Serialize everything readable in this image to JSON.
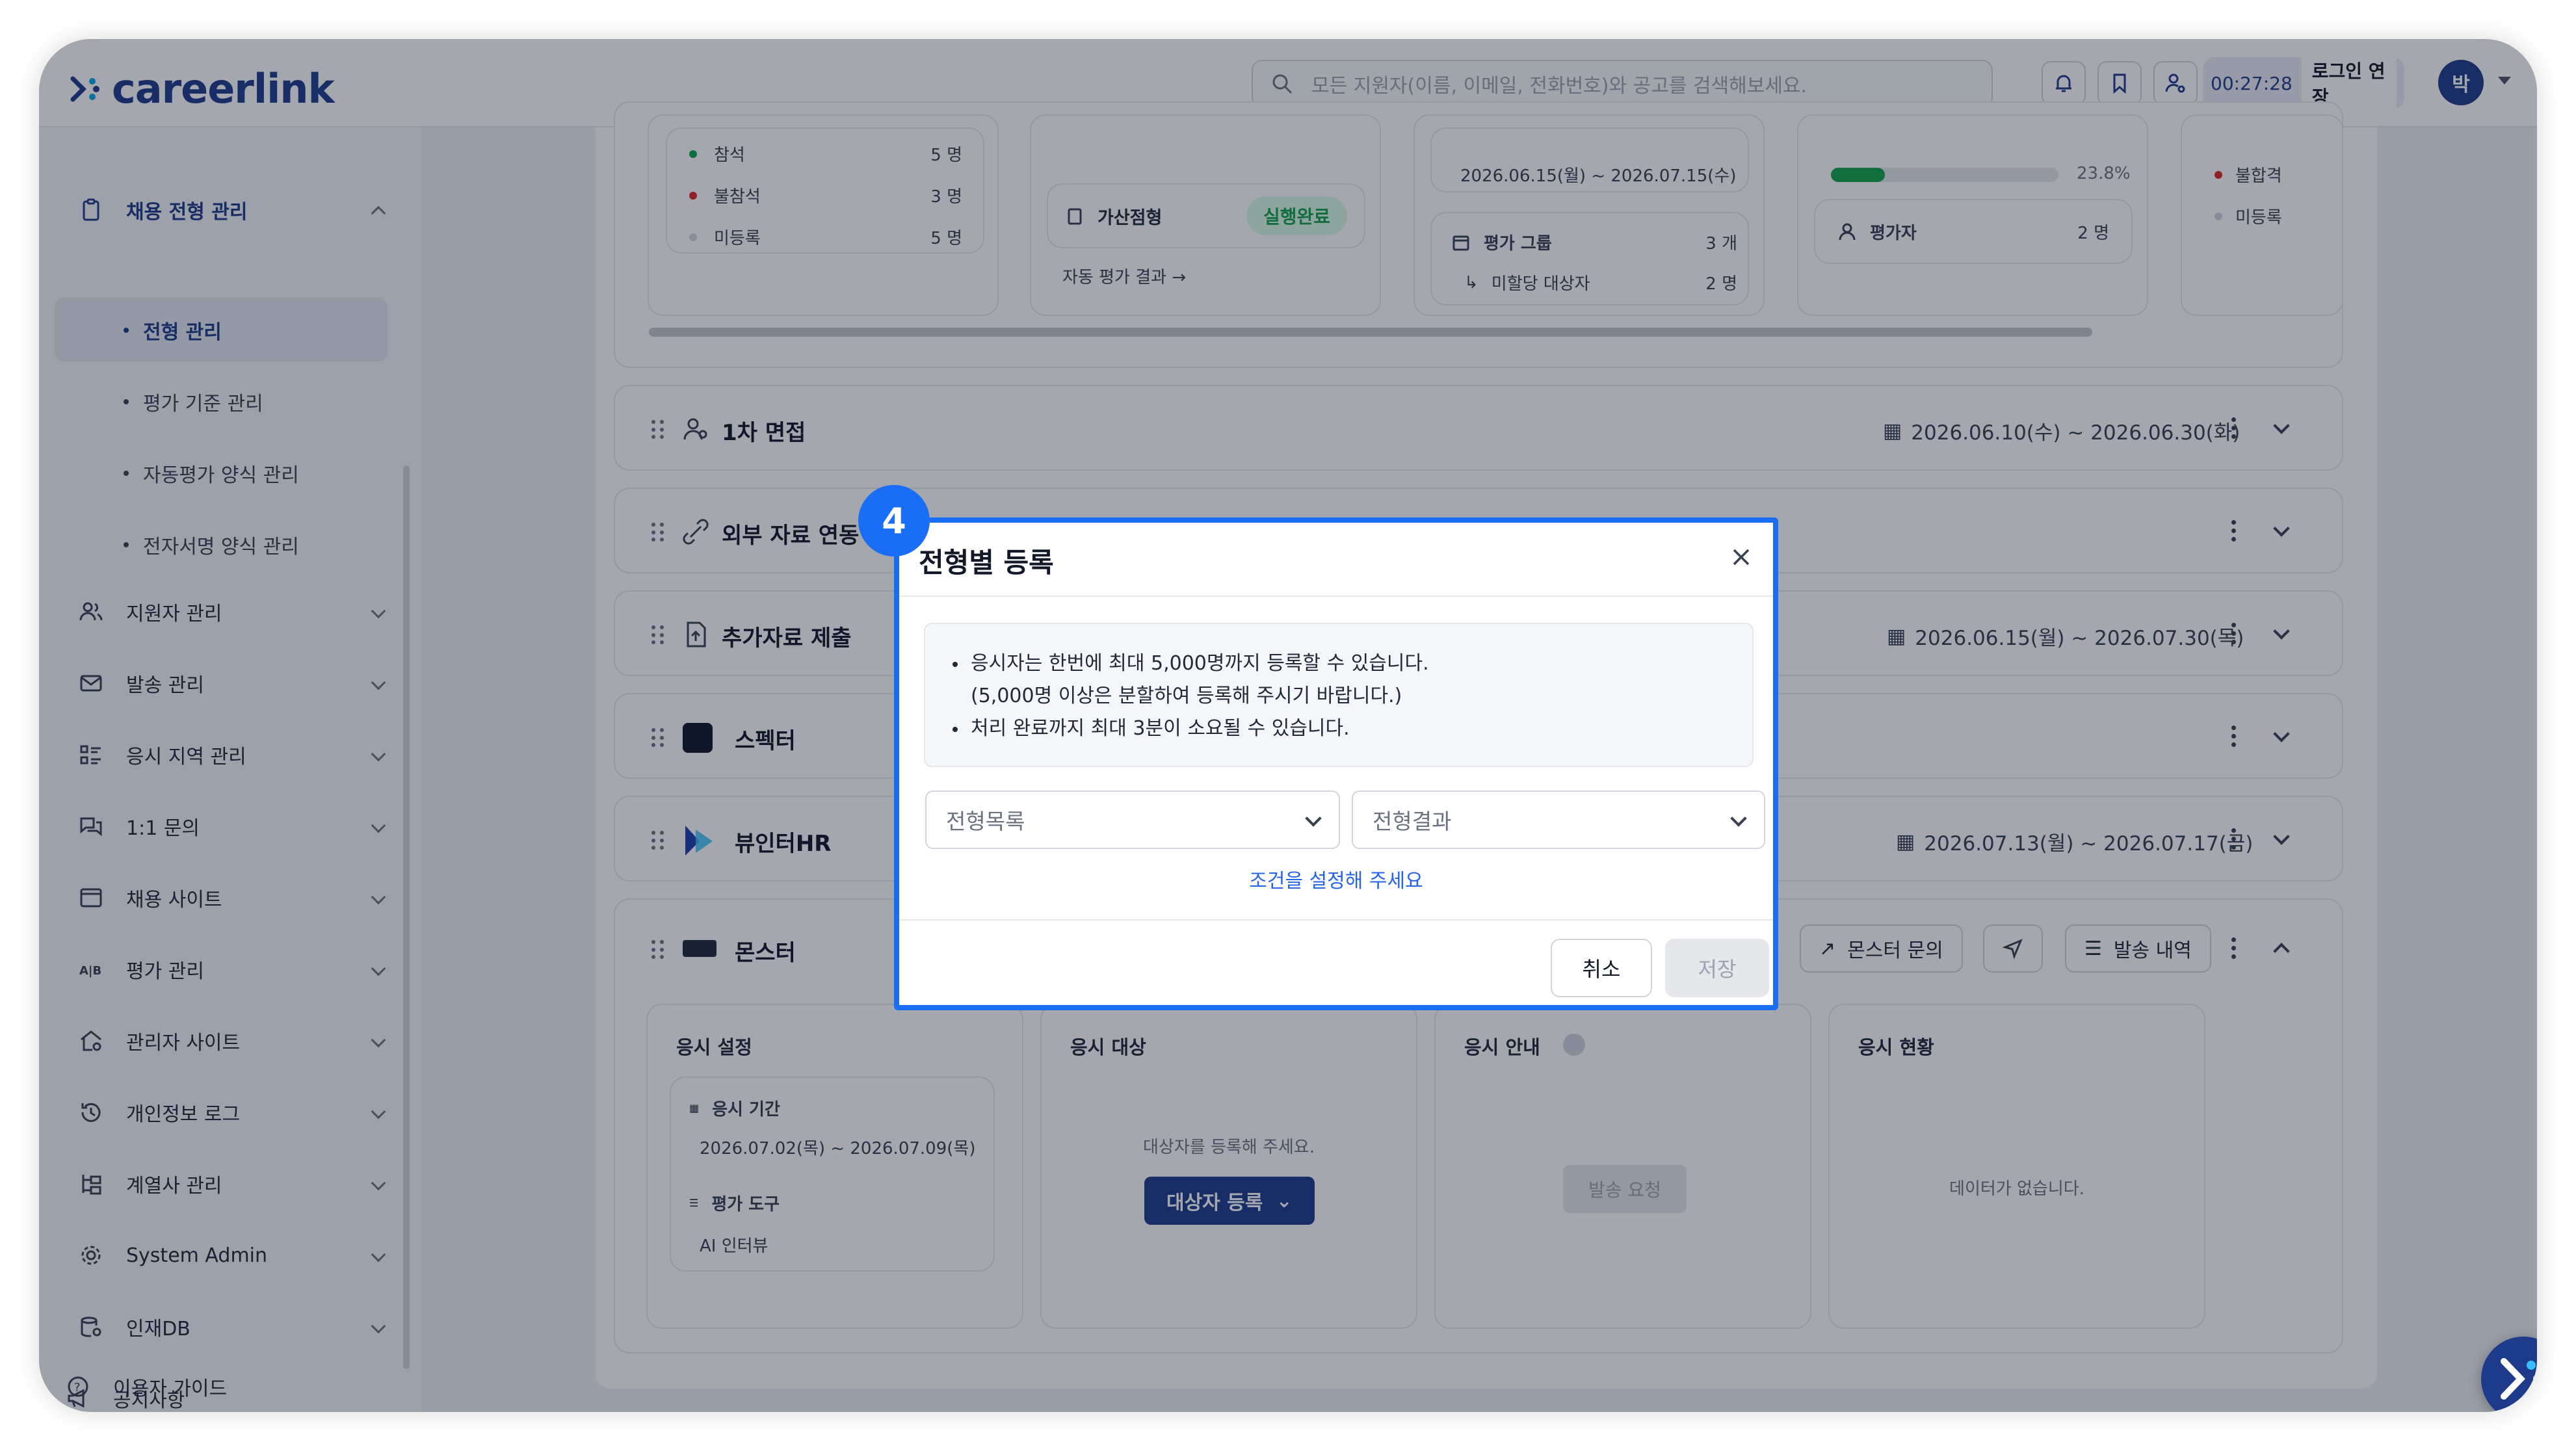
{
  "brand": {
    "name": "careerlink"
  },
  "search": {
    "placeholder": "모든 지원자(이름, 이메일, 전화번호)와 공고를 검색해보세요."
  },
  "session": {
    "timer": "00:27:28",
    "extend_label": "로그인 연장"
  },
  "user": {
    "avatar_initial": "박"
  },
  "sidebar": {
    "section_open": "채용 전형 관리",
    "sub_items": [
      "전형 관리",
      "평가 기준 관리",
      "자동평가 양식 관리",
      "전자서명 양식 관리"
    ],
    "items": [
      "지원자 관리",
      "발송 관리",
      "응시 지역 관리",
      "1:1 문의",
      "채용 사이트",
      "평가 관리",
      "관리자 사이트",
      "개인정보 로그",
      "계열사 관리",
      "System Admin",
      "인재DB"
    ],
    "bottom": [
      "공지사항",
      "이용자 가이드"
    ]
  },
  "top_cards": {
    "attendance": [
      {
        "label": "참석",
        "count": "5 명",
        "color": "#16a34a"
      },
      {
        "label": "불참석",
        "count": "3 명",
        "color": "#dc2626"
      },
      {
        "label": "미등록",
        "count": "5 명",
        "color": "#d1d5db"
      }
    ],
    "bonus_label": "가산점형",
    "bonus_status": "실행완료",
    "auto_eval_link": "자동 평가 결과 →",
    "period": "2026.06.15(월) ~ 2026.07.15(수)",
    "eval_group_label": "평가 그룹",
    "eval_group_count": "3 개",
    "unassigned_label": "미할당 대상자",
    "unassigned_count": "2 명",
    "progress_pct": "23.8%",
    "progress_value": 0.238,
    "evaluator_label": "평가자",
    "evaluator_count": "2 명",
    "fail_label": "불합격",
    "unreg_label": "미등록"
  },
  "rows": [
    {
      "title": "1차 면접",
      "date": "2026.06.10(수) ~ 2026.06.30(화)"
    },
    {
      "title": "외부 자료 연동",
      "date": ""
    },
    {
      "title": "추가자료 제출",
      "date": "2026.06.15(월) ~ 2026.07.30(목)"
    },
    {
      "title": "스펙터",
      "date": ""
    },
    {
      "title": "뷰인터HR",
      "date": "2026.07.13(월) ~ 2026.07.17(금)"
    },
    {
      "title": "몬스터",
      "date": ""
    }
  ],
  "monster": {
    "inquiry_label": "몬스터 문의",
    "history_label": "발송 내역",
    "settings_title": "응시 설정",
    "period_label": "응시 기간",
    "period_value": "2026.07.02(목) ~ 2026.07.09(목)",
    "tool_label": "평가 도구",
    "tool_value": "AI 인터뷰",
    "target_title": "응시 대상",
    "target_hint": "대상자를 등록해 주세요.",
    "target_button": "대상자 등록",
    "guide_title": "응시 안내",
    "guide_button": "발송 요청",
    "status_title": "응시 현황",
    "status_empty": "데이터가 없습니다."
  },
  "modal": {
    "step": "4",
    "title": "전형별 등록",
    "info": [
      "응시자는 한번에 최대 5,000명까지 등록할 수 있습니다.",
      "(5,000명 이상은 분할하여 등록해 주시기 바랍니다.)",
      "처리 완료까지 최대 3분이 소요될 수 있습니다."
    ],
    "select_list": "전형목록",
    "select_result": "전형결과",
    "hint": "조건을 설정해 주세요",
    "cancel": "취소",
    "save": "저장"
  },
  "colors": {
    "brand": "#1e3a8a",
    "accent": "#1a6ef5",
    "success": "#16a34a",
    "danger": "#dc2626"
  }
}
